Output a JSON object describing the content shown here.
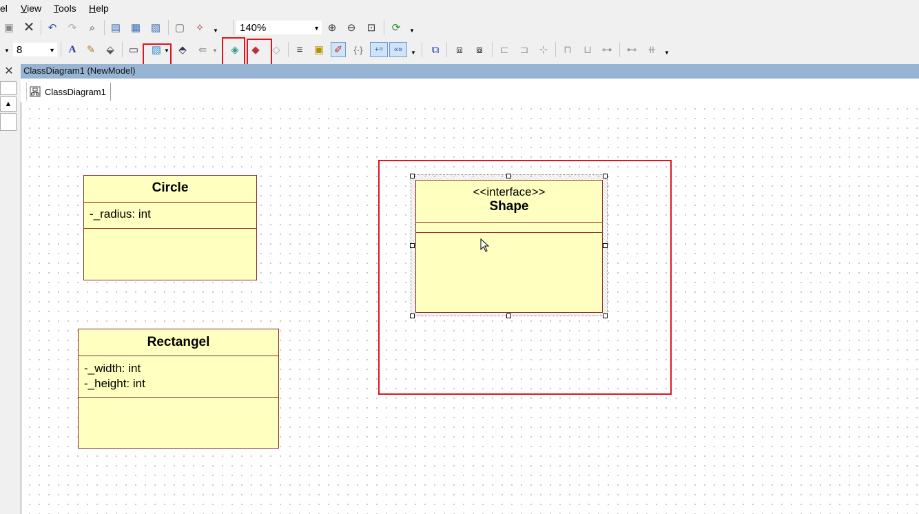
{
  "menu": {
    "items": [
      "el",
      "View",
      "Tools",
      "Help"
    ],
    "view_accel": "V",
    "tools_accel": "T",
    "help_accel": "H",
    "view_rest": "iew",
    "tools_rest": "ools",
    "help_rest": "elp"
  },
  "toolbar": {
    "zoom_value": "140%",
    "font_size_value": "8"
  },
  "document": {
    "title": "ClassDiagram1 (NewModel)",
    "tab_label": "ClassDiagram1"
  },
  "diagram": {
    "classes": [
      {
        "name": "Circle",
        "attributes": [
          "-_radius: int"
        ]
      },
      {
        "name": "Rectangel",
        "attributes": [
          "-_width: int",
          "-_height: int"
        ]
      },
      {
        "name": "Shape",
        "stereotype": "<<interface>>",
        "attributes": []
      }
    ]
  },
  "colors": {
    "highlight": "#e0141e",
    "class_fill": "#ffffc0",
    "class_border": "#8b2b2b",
    "title_bar": "#98b4d4"
  }
}
